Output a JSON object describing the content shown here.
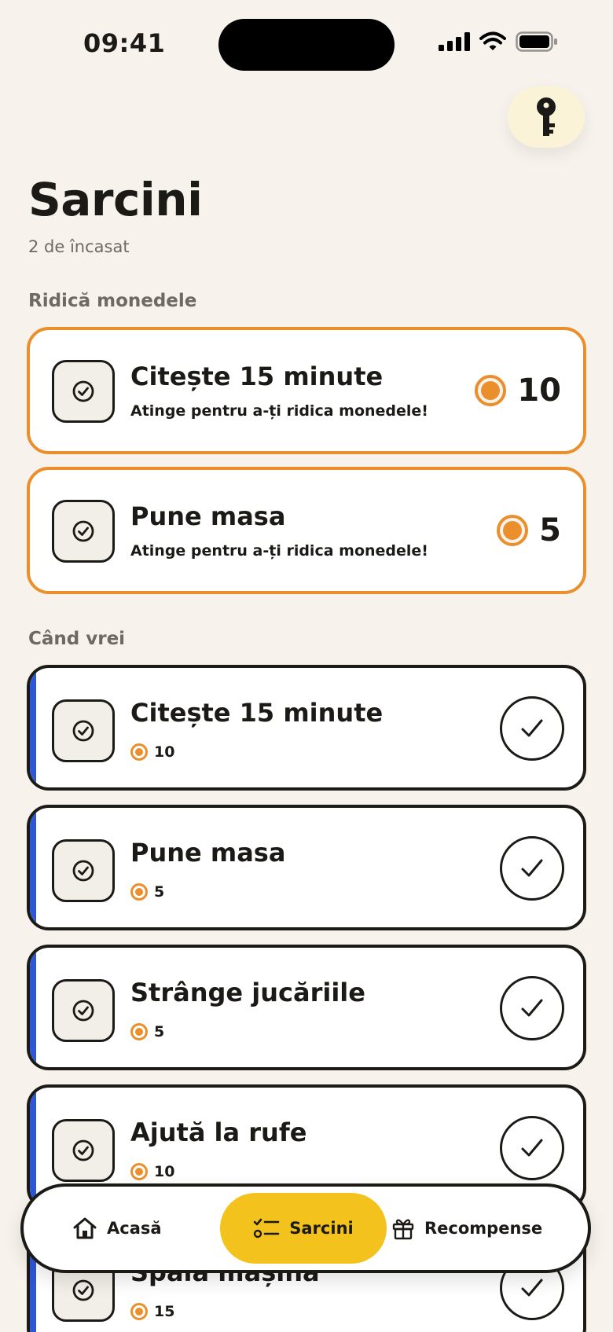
{
  "status_bar": {
    "time": "09:41"
  },
  "header": {
    "title": "Sarcini",
    "subtitle": "2 de încasat"
  },
  "sections": {
    "pending_label": "Ridică monedele",
    "anytime_label": "Când vrei"
  },
  "pending_tasks": [
    {
      "title": "Citește 15 minute",
      "hint": "Atinge pentru a-ți ridica monedele!",
      "coins": "10"
    },
    {
      "title": "Pune masa",
      "hint": "Atinge pentru a-ți ridica monedele!",
      "coins": "5"
    }
  ],
  "tasks": [
    {
      "title": "Citește 15 minute",
      "coins": "10"
    },
    {
      "title": "Pune masa",
      "coins": "5"
    },
    {
      "title": "Strânge jucăriile",
      "coins": "5"
    },
    {
      "title": "Ajută la rufe",
      "coins": "10"
    },
    {
      "title": "Spală mașina",
      "coins": "15"
    }
  ],
  "nav": {
    "home": "Acasă",
    "tasks": "Sarcini",
    "rewards": "Recompense",
    "active": "tasks"
  },
  "colors": {
    "background": "#f7f3ec",
    "accent_orange": "#ea8f2c",
    "accent_yellow": "#f4c21c",
    "stripe_blue": "#2e57d6",
    "ink": "#1c1a17"
  },
  "icons": {
    "key": "key-icon",
    "task": "check-circle-icon",
    "complete": "checkmark-icon",
    "coin": "coin-icon",
    "home": "home-icon",
    "tasks": "checklist-icon",
    "rewards": "gift-icon"
  }
}
